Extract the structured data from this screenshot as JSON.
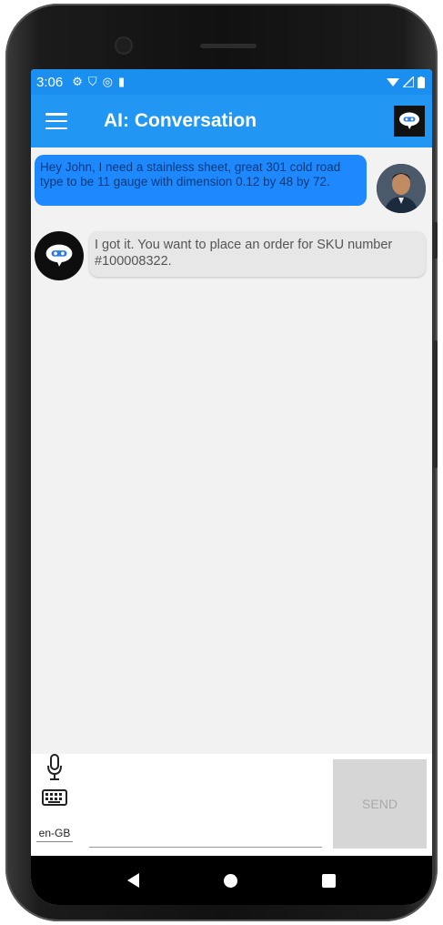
{
  "status_bar": {
    "time": "3:06"
  },
  "app_bar": {
    "title": "AI: Conversation"
  },
  "conversation": {
    "messages": [
      {
        "sender": "user",
        "text": "Hey John, I need a stainless sheet, great 301 cold road type to be 11 gauge with dimension 0.12 by 48 by 72."
      },
      {
        "sender": "bot",
        "text": "I got it. You want to place an order for SKU number #100008322."
      }
    ]
  },
  "input_bar": {
    "locale": "en-GB",
    "message_value": "",
    "send_label": "SEND"
  },
  "colors": {
    "status_bar": "#1a8ff0",
    "app_bar": "#2196f3",
    "user_bubble": "#1e88ff",
    "bot_bubble": "#e7e7e7",
    "send_button_disabled": "#d6d6d6"
  },
  "icons": {
    "menu": "hamburger-menu-icon",
    "logo": "chat-bubble-logo-icon",
    "mic": "microphone-icon",
    "keyboard": "keyboard-icon",
    "nav_back": "back-triangle-icon",
    "nav_home": "home-circle-icon",
    "nav_recents": "recents-square-icon"
  }
}
